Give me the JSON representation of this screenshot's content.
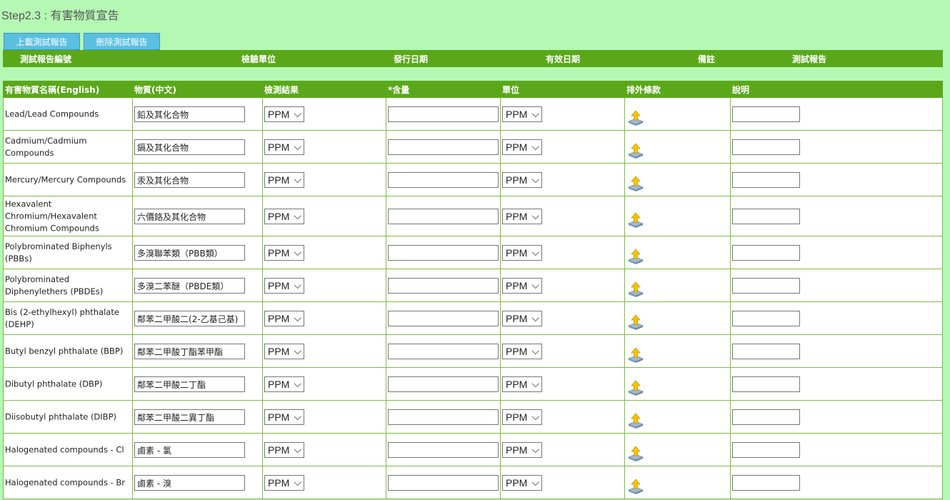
{
  "page": {
    "title": "Step2.3 : 有害物質宣告"
  },
  "buttons": {
    "upload_label": "上載測試報告",
    "delete_label": "刪除測試報告"
  },
  "report_table": {
    "headers": [
      "測試報告編號",
      "檢驗單位",
      "發行日期",
      "有效日期",
      "備註",
      "測試報告"
    ]
  },
  "substance_table": {
    "headers": [
      "有害物質名稱(English)",
      "物質(中文)",
      "檢測結果",
      "*含量",
      "單位",
      "排外條款",
      "說明"
    ],
    "rows": [
      {
        "en": "Lead/Lead Compounds",
        "cn": "鉛及其化合物",
        "result": "PPM",
        "unit": "PPM"
      },
      {
        "en": "Cadmium/Cadmium Compounds",
        "cn": "鎘及其化合物",
        "result": "PPM",
        "unit": "PPM"
      },
      {
        "en": "Mercury/Mercury Compounds",
        "cn": "汞及其化合物",
        "result": "PPM",
        "unit": "PPM"
      },
      {
        "en": "Hexavalent Chromium/Hexavalent Chromium Compounds",
        "cn": "六價鉻及其化合物",
        "result": "PPM",
        "unit": "PPM"
      },
      {
        "en": "Polybrominated Biphenyls (PBBs)",
        "cn": "多溴聯苯類（PBB類）",
        "result": "PPM",
        "unit": "PPM"
      },
      {
        "en": "Polybrominated Diphenylethers (PBDEs)",
        "cn": "多溴二苯醚（PBDE類）",
        "result": "PPM",
        "unit": "PPM"
      },
      {
        "en": "Bis (2-ethylhexyl) phthalate (DEHP)",
        "cn": "鄰苯二甲酸二(2-乙基己基)",
        "result": "PPM",
        "unit": "PPM"
      },
      {
        "en": "Butyl benzyl phthalate (BBP)",
        "cn": "鄰苯二甲酸丁酯苯甲酯",
        "result": "PPM",
        "unit": "PPM"
      },
      {
        "en": "Dibutyl phthalate (DBP)",
        "cn": "鄰苯二甲酸二丁酯",
        "result": "PPM",
        "unit": "PPM"
      },
      {
        "en": "Diisobutyl phthalate (DIBP)",
        "cn": "鄰苯二甲酸二異丁酯",
        "result": "PPM",
        "unit": "PPM"
      },
      {
        "en": "Halogenated compounds - Cl",
        "cn": "鹵素 - 氯",
        "result": "PPM",
        "unit": "PPM"
      },
      {
        "en": "Halogenated compounds - Br",
        "cn": "鹵素 - 溴",
        "result": "PPM",
        "unit": "PPM"
      }
    ]
  },
  "icons": {
    "exclusion": "upload-arrow-icon"
  },
  "colors": {
    "background": "#b4f8b4",
    "header_green": "#5aa81a",
    "button_blue": "#5bbfe0"
  }
}
